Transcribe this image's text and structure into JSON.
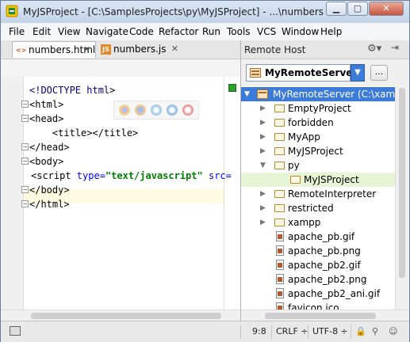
{
  "window": {
    "title": "MyJSProject - [C:\\SamplesProjects\\py\\MyJSProject] - ...\\numbers.html...",
    "controls": {
      "minimize": "▁",
      "maximize": "▢",
      "close": "✕"
    }
  },
  "menu": [
    "File",
    "Edit",
    "View",
    "Navigate",
    "Code",
    "Refactor",
    "Run",
    "Tools",
    "VCS",
    "Window",
    "Help"
  ],
  "editor": {
    "tabs": [
      {
        "label": "numbers.html",
        "icon": "html-file-icon",
        "close": "✕"
      },
      {
        "label": "numbers.js",
        "icon": "js-file-icon",
        "close": "✕"
      }
    ],
    "lines": [
      "<!DOCTYPE html>",
      "<html>",
      "<head>",
      "    <title></title>",
      "</head>",
      "<body>",
      "<script type=\"text/javascript\" src=",
      "</body>",
      "</html>"
    ],
    "code_parts": {
      "doctype_kw": "<!DOCTYPE",
      "doctype_val": " html",
      "doctype_end": ">",
      "script_open": "<script ",
      "script_attr1": "type=",
      "script_val1": "\"text/javascript\"",
      "script_attr2": " src="
    }
  },
  "remote_host": {
    "title": "Remote Host",
    "server": "MyRemoteServer",
    "more": "...",
    "tree": [
      {
        "label": "MyRemoteServer (C:\\xampp\\htdocs)",
        "type": "root"
      },
      {
        "label": "EmptyProject",
        "type": "folder"
      },
      {
        "label": "forbidden",
        "type": "folder"
      },
      {
        "label": "MyApp",
        "type": "folder"
      },
      {
        "label": "MyJSProject",
        "type": "folder"
      },
      {
        "label": "py",
        "type": "folder-open"
      },
      {
        "label": "MyJSProject",
        "type": "folder-selected"
      },
      {
        "label": "RemoteInterpreter",
        "type": "folder"
      },
      {
        "label": "restricted",
        "type": "folder"
      },
      {
        "label": "xampp",
        "type": "folder"
      },
      {
        "label": "apache_pb.gif",
        "type": "file"
      },
      {
        "label": "apache_pb.png",
        "type": "file"
      },
      {
        "label": "apache_pb2.gif",
        "type": "file"
      },
      {
        "label": "apache_pb2.png",
        "type": "file"
      },
      {
        "label": "apache_pb2_ani.gif",
        "type": "file"
      },
      {
        "label": "favicon.ico",
        "type": "file"
      }
    ]
  },
  "status": {
    "position": "9:8",
    "line_ending": "CRLF ÷",
    "encoding": "UTF-8 ÷"
  },
  "colors": {
    "accent": "#3d7bd8",
    "selection": "#e7f5d6",
    "marker": "#2e9e2e"
  }
}
